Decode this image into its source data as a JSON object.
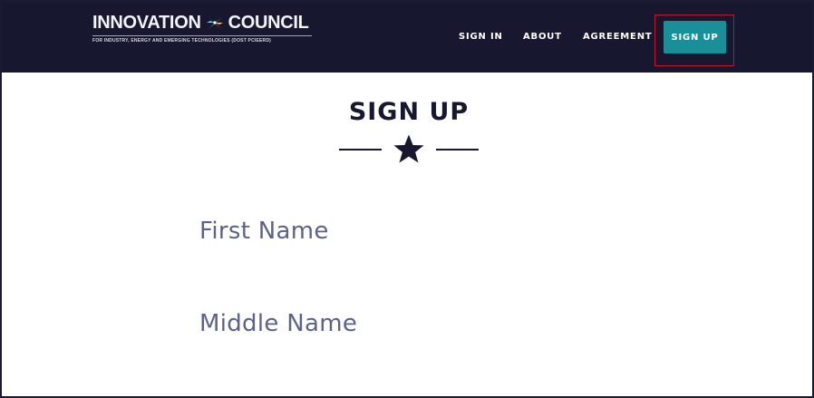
{
  "brand": {
    "title_left": "INNOVATION",
    "title_right": "COUNCIL",
    "subtitle": "FOR INDUSTRY, ENERGY AND EMERGING TECHNOLOGIES (DOST PCIEERD)",
    "logo_icon": "pinwheel-logo-icon"
  },
  "nav": {
    "items": [
      {
        "label": "SIGN IN"
      },
      {
        "label": "ABOUT"
      },
      {
        "label": "AGREEMENT"
      }
    ],
    "cta_label": "SIGN UP",
    "cta_color": "#1a8f98",
    "highlight_color": "#c7102a"
  },
  "main": {
    "title": "SIGN UP",
    "divider_icon": "star-icon",
    "fields": [
      {
        "label": "First Name"
      },
      {
        "label": "Middle Name"
      }
    ]
  },
  "colors": {
    "navbar_bg": "#17172f",
    "label_text": "#5c6288",
    "title_text": "#17172f"
  }
}
